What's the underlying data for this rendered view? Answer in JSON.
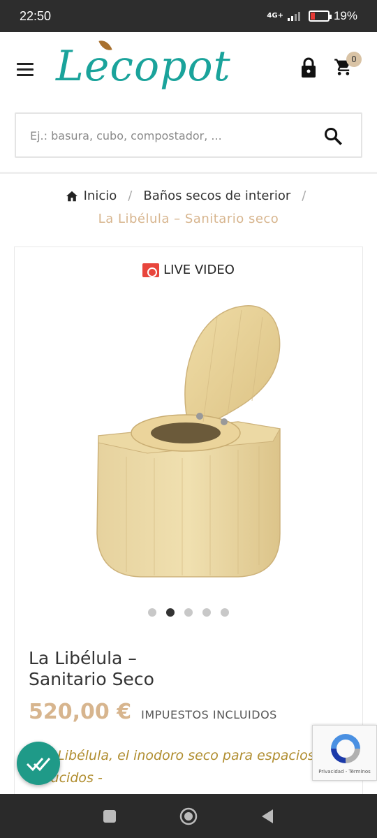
{
  "status_bar": {
    "time": "22:50",
    "network": "4G+",
    "battery_percent": "19%",
    "battery_level": 0.19
  },
  "header": {
    "logo_text": "Lecopot",
    "cart_count": "0",
    "colors": {
      "logo": "#1aa39b",
      "accent": "#d7b58e"
    }
  },
  "search": {
    "placeholder": "Ej.: basura, cubo, compostador, ..."
  },
  "breadcrumb": {
    "home": "Inicio",
    "category": "Baños secos de interior",
    "current": "La Libélula – Sanitario seco",
    "separator": "/"
  },
  "product": {
    "live_label": "LIVE VIDEO",
    "title_line1": "La Libélula –",
    "title_line2": "Sanitario Seco",
    "price": "520,00 €",
    "tax_note": "IMPUESTOS INCLUIDOS",
    "desc_line1": "- La Libélula, el inodoro seco para espacios",
    "desc_line2": "reducidos -",
    "carousel_total": 5,
    "carousel_active_index": 1
  },
  "recaptcha": {
    "links": "Privacidad - Términos"
  }
}
